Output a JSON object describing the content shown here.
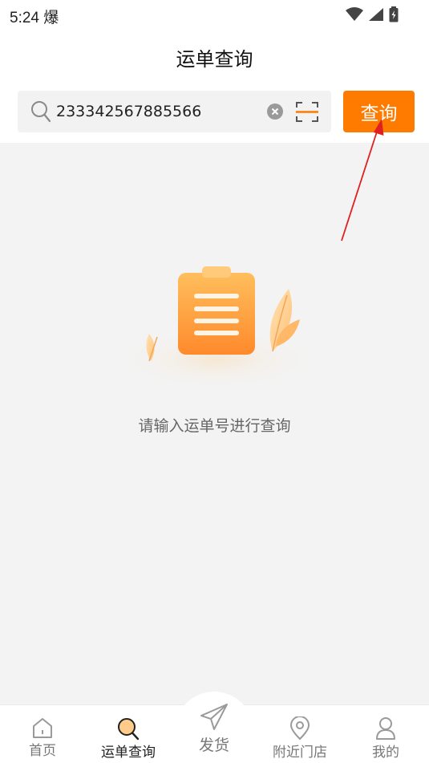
{
  "status_bar": {
    "time": "5:24",
    "notification_glyph": "爆",
    "icons": [
      "wifi-icon",
      "signal-icon",
      "battery-icon"
    ]
  },
  "header": {
    "title": "运单查询"
  },
  "search": {
    "value": "233342567885566",
    "placeholder": "",
    "button_label": "查询"
  },
  "empty_state": {
    "message": "请输入运单号进行查询"
  },
  "bottom_nav": {
    "items": [
      {
        "label": "首页",
        "icon": "home-icon",
        "active": false
      },
      {
        "label": "运单查询",
        "icon": "search-icon",
        "active": true
      },
      {
        "label": "发货",
        "icon": "paper-plane-icon",
        "active": false
      },
      {
        "label": "附近门店",
        "icon": "location-pin-icon",
        "active": false
      },
      {
        "label": "我的",
        "icon": "user-icon",
        "active": false
      }
    ]
  },
  "colors": {
    "accent": "#ff7b00",
    "annotation": "#e02020"
  }
}
